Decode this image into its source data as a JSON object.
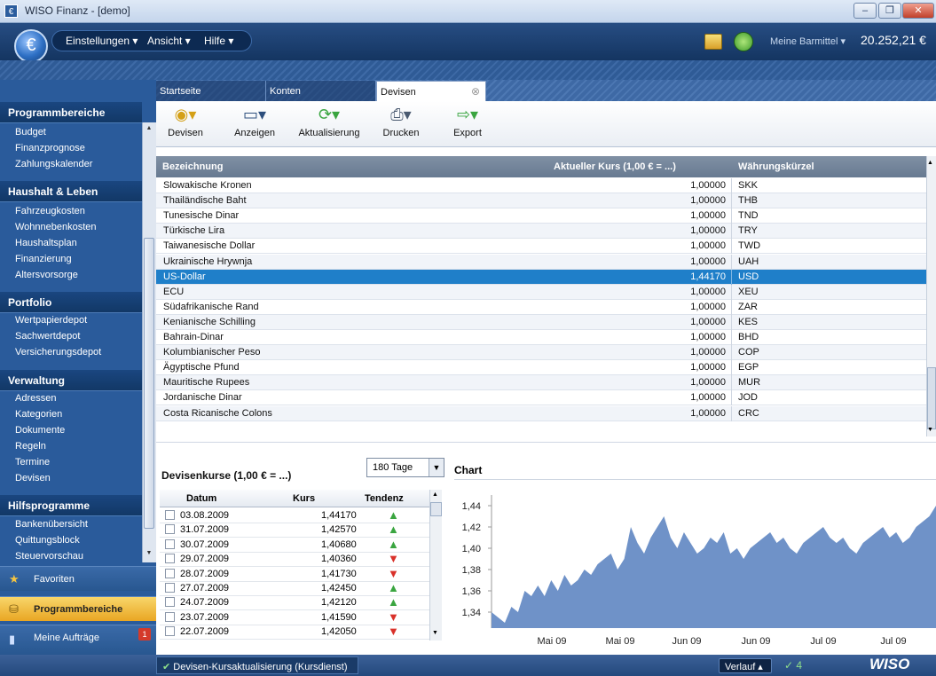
{
  "window": {
    "title": "WISO Finanz - [demo]",
    "app_icon": "€",
    "minimize": "–",
    "restore": "❐",
    "close": "✕"
  },
  "menu": {
    "logo": "€",
    "items": [
      {
        "label": "Einstellungen ▾"
      },
      {
        "label": "Ansicht ▾"
      },
      {
        "label": "Hilfe ▾"
      }
    ],
    "barmittel_label": "Meine Barmittel ▾",
    "balance": "20.252,21 €"
  },
  "tabs": [
    {
      "label": "Startseite"
    },
    {
      "label": "Konten"
    },
    {
      "label": "Devisen",
      "close": "⊗"
    }
  ],
  "sidebar": {
    "sections": [
      {
        "title": "Programmbereiche",
        "items": [
          "Budget",
          "Finanzprognose",
          "Zahlungskalender"
        ]
      },
      {
        "title": "Haushalt & Leben",
        "items": [
          "Fahrzeugkosten",
          "Wohnnebenkosten",
          "Haushaltsplan",
          "Finanzierung",
          "Altersvorsorge"
        ]
      },
      {
        "title": "Portfolio",
        "items": [
          "Wertpapierdepot",
          "Sachwertdepot",
          "Versicherungsdepot"
        ]
      },
      {
        "title": "Verwaltung",
        "items": [
          "Adressen",
          "Kategorien",
          "Dokumente",
          "Regeln",
          "Termine",
          "Devisen"
        ]
      },
      {
        "title": "Hilfsprogramme",
        "items": [
          "Bankenübersicht",
          "Quittungsblock",
          "Steuervorschau"
        ]
      }
    ],
    "nav": [
      {
        "label": "Favoriten",
        "icon": "star-icon"
      },
      {
        "label": "Programmbereiche",
        "icon": "database-icon"
      },
      {
        "label": "Meine Aufträge",
        "icon": "tasks-icon",
        "badge": "1"
      }
    ]
  },
  "toolbar": {
    "buttons": [
      {
        "label": "Devisen",
        "icon": "coins-icon"
      },
      {
        "label": "Anzeigen",
        "icon": "monitor-icon"
      },
      {
        "label": "Aktualisierung",
        "icon": "refresh-icon"
      },
      {
        "label": "Drucken",
        "icon": "printer-icon"
      },
      {
        "label": "Export",
        "icon": "export-icon"
      }
    ]
  },
  "grid": {
    "columns": [
      "Bezeichnung",
      "Aktueller Kurs (1,00 € = ...)",
      "Währungskürzel"
    ],
    "rows": [
      {
        "name": "Slowakische Kronen",
        "rate": "1,00000",
        "code": "SKK"
      },
      {
        "name": "Thailändische Baht",
        "rate": "1,00000",
        "code": "THB"
      },
      {
        "name": "Tunesische Dinar",
        "rate": "1,00000",
        "code": "TND"
      },
      {
        "name": "Türkische Lira",
        "rate": "1,00000",
        "code": "TRY"
      },
      {
        "name": "Taiwanesische Dollar",
        "rate": "1,00000",
        "code": "TWD"
      },
      {
        "name": "Ukrainische Hrywnja",
        "rate": "1,00000",
        "code": "UAH"
      },
      {
        "name": "US-Dollar",
        "rate": "1,44170",
        "code": "USD",
        "selected": true
      },
      {
        "name": "ECU",
        "rate": "1,00000",
        "code": "XEU"
      },
      {
        "name": "Südafrikanische Rand",
        "rate": "1,00000",
        "code": "ZAR"
      },
      {
        "name": "Kenianische Schilling",
        "rate": "1,00000",
        "code": "KES"
      },
      {
        "name": "Bahrain-Dinar",
        "rate": "1,00000",
        "code": "BHD"
      },
      {
        "name": "Kolumbianischer Peso",
        "rate": "1,00000",
        "code": "COP"
      },
      {
        "name": "Ägyptische Pfund",
        "rate": "1,00000",
        "code": "EGP"
      },
      {
        "name": "Mauritische Rupees",
        "rate": "1,00000",
        "code": "MUR"
      },
      {
        "name": "Jordanische Dinar",
        "rate": "1,00000",
        "code": "JOD"
      },
      {
        "name": "Costa Ricanische Colons",
        "rate": "1,00000",
        "code": "CRC"
      }
    ]
  },
  "history": {
    "title": "Devisenkurse (1,00 € = ...)",
    "range": "180 Tage",
    "columns": [
      "Datum",
      "Kurs",
      "Tendenz"
    ],
    "rows": [
      {
        "date": "03.08.2009",
        "rate": "1,44170",
        "trend": "up"
      },
      {
        "date": "31.07.2009",
        "rate": "1,42570",
        "trend": "up"
      },
      {
        "date": "30.07.2009",
        "rate": "1,40680",
        "trend": "up"
      },
      {
        "date": "29.07.2009",
        "rate": "1,40360",
        "trend": "down"
      },
      {
        "date": "28.07.2009",
        "rate": "1,41730",
        "trend": "down"
      },
      {
        "date": "27.07.2009",
        "rate": "1,42450",
        "trend": "up"
      },
      {
        "date": "24.07.2009",
        "rate": "1,42120",
        "trend": "up"
      },
      {
        "date": "23.07.2009",
        "rate": "1,41590",
        "trend": "down"
      },
      {
        "date": "22.07.2009",
        "rate": "1,42050",
        "trend": "down"
      }
    ]
  },
  "chart_data": {
    "type": "area",
    "title": "Chart",
    "x_tick_labels": [
      "Mai 09",
      "Mai 09",
      "Jun 09",
      "Jun 09",
      "Jul 09",
      "Jul 09"
    ],
    "y_tick_labels": [
      "1,44",
      "1,42",
      "1,40",
      "1,38",
      "1,36",
      "1,34"
    ],
    "ylim": [
      1.325,
      1.45
    ],
    "color": "#6f92c8",
    "series": [
      {
        "values": [
          1.34,
          1.335,
          1.33,
          1.345,
          1.34,
          1.36,
          1.355,
          1.365,
          1.355,
          1.37,
          1.36,
          1.375,
          1.365,
          1.37,
          1.38,
          1.375,
          1.385,
          1.39,
          1.395,
          1.38,
          1.39,
          1.42,
          1.405,
          1.395,
          1.41,
          1.42,
          1.43,
          1.41,
          1.4,
          1.415,
          1.405,
          1.395,
          1.4,
          1.41,
          1.405,
          1.415,
          1.395,
          1.4,
          1.39,
          1.4,
          1.405,
          1.41,
          1.415,
          1.405,
          1.41,
          1.4,
          1.395,
          1.405,
          1.41,
          1.415,
          1.42,
          1.41,
          1.405,
          1.41,
          1.4,
          1.395,
          1.405,
          1.41,
          1.415,
          1.42,
          1.41,
          1.415,
          1.405,
          1.41,
          1.42,
          1.425,
          1.43,
          1.44
        ]
      }
    ]
  },
  "statusbar": {
    "message": "Devisen-Kursaktualisierung (Kursdienst)",
    "verlauf": "Verlauf ▴",
    "count": "✓ 4",
    "brand": "WISO"
  }
}
